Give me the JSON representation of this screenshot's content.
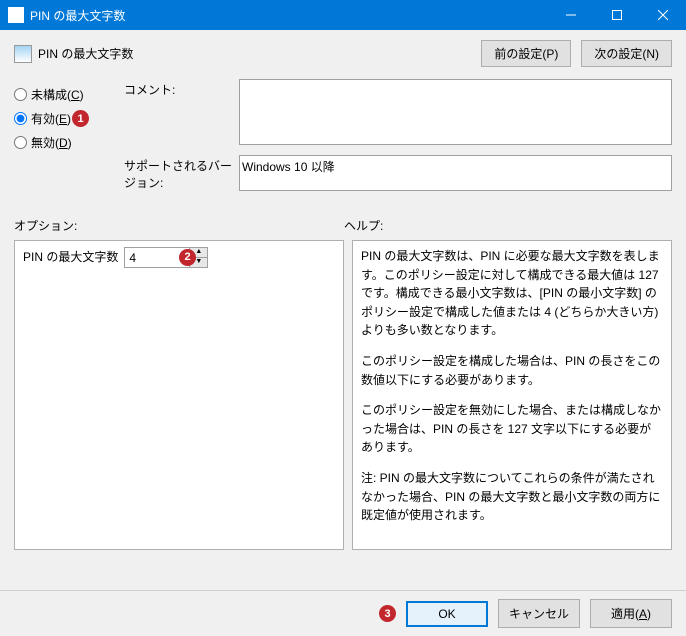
{
  "titlebar": {
    "title": "PIN の最大文字数"
  },
  "header": {
    "page_title": "PIN の最大文字数",
    "prev_btn": "前の設定(P)",
    "next_btn": "次の設定(N)"
  },
  "radio": {
    "not_configured": "未構成(C)",
    "enabled": "有効(E)",
    "disabled": "無効(D)",
    "selected": "enabled"
  },
  "fields": {
    "comment_label": "コメント:",
    "comment_value": "",
    "supported_label": "サポートされるバージョン:",
    "supported_value": "Windows 10 以降"
  },
  "sections": {
    "options_label": "オプション:",
    "help_label": "ヘルプ:"
  },
  "option": {
    "spin_label": "PIN の最大文字数",
    "spin_value": "4"
  },
  "help": {
    "p1": "PIN の最大文字数は、PIN に必要な最大文字数を表します。このポリシー設定に対して構成できる最大値は 127 です。構成できる最小文字数は、[PIN の最小文字数] のポリシー設定で構成した値または 4 (どちらか大きい方) よりも多い数となります。",
    "p2": "このポリシー設定を構成した場合は、PIN の長さをこの数値以下にする必要があります。",
    "p3": "このポリシー設定を無効にした場合、または構成しなかった場合は、PIN の長さを 127 文字以下にする必要があります。",
    "p4": "注: PIN の最大文字数についてこれらの条件が満たされなかった場合、PIN の最大文字数と最小文字数の両方に既定値が使用されます。"
  },
  "footer": {
    "ok": "OK",
    "cancel": "キャンセル",
    "apply": "適用(A)"
  },
  "markers": {
    "one": "1",
    "two": "2",
    "three": "3"
  }
}
